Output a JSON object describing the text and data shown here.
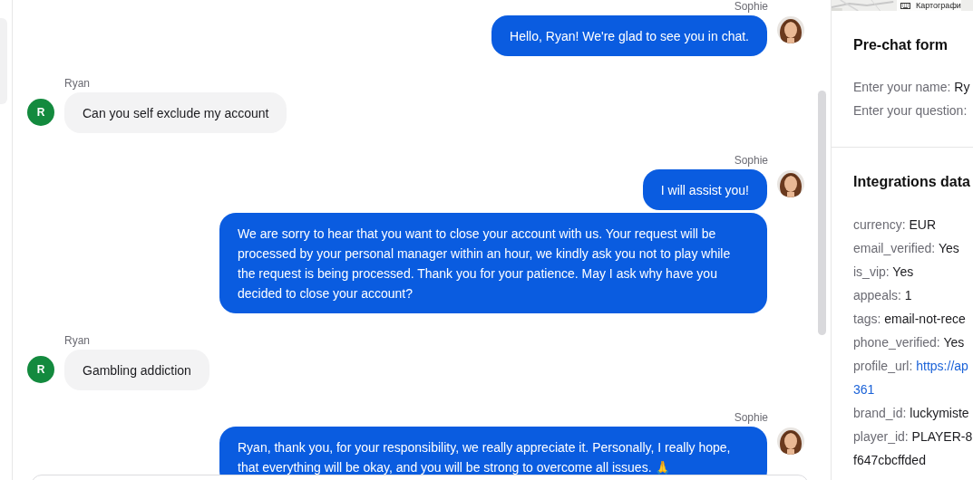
{
  "map_strip": {
    "attribution": "Картографи"
  },
  "chat": {
    "groups": [
      {
        "author": "Sophie",
        "kind": "agent",
        "avatar": {
          "kind": "picture"
        },
        "messages": [
          "Hello, Ryan! We're glad to see you in chat."
        ]
      },
      {
        "author": "Ryan",
        "kind": "visitor",
        "avatar": {
          "kind": "initial",
          "initial": "R",
          "color": "#138a3e"
        },
        "messages": [
          "Can you self exclude my account"
        ]
      },
      {
        "author": "Sophie",
        "kind": "agent",
        "avatar": {
          "kind": "picture"
        },
        "messages": [
          "I will assist you!",
          "We are sorry to hear that you want to close your account with us. Your request will be processed by your personal manager within an hour, we kindly ask you not to play while the request is being processed. Thank you for your patience. May I ask why have you decided to close your account?"
        ]
      },
      {
        "author": "Ryan",
        "kind": "visitor",
        "avatar": {
          "kind": "initial",
          "initial": "R",
          "color": "#138a3e"
        },
        "messages": [
          "Gambling addiction"
        ]
      },
      {
        "author": "Sophie",
        "kind": "agent",
        "avatar": {
          "kind": "picture"
        },
        "messages": [
          "Ryan, thank you, for your responsibility, we really appreciate it. Personally, I really hope, that everything will be okay, and you will be strong to overcome all issues. 🙏"
        ]
      }
    ]
  },
  "sidebar": {
    "sections": [
      {
        "title": "Pre-chat form",
        "items": [
          {
            "label": "Enter your name:",
            "value_lines": [
              "Ry"
            ],
            "kind": "text"
          },
          {
            "label": "Enter your question:",
            "kind": "text"
          }
        ]
      },
      {
        "title": "Integrations data",
        "items": [
          {
            "label": "currency:",
            "value_lines": [
              "EUR"
            ],
            "kind": "text"
          },
          {
            "label": "email_verified:",
            "value_lines": [
              "Yes"
            ],
            "kind": "text"
          },
          {
            "label": "is_vip:",
            "value_lines": [
              "Yes"
            ],
            "kind": "text"
          },
          {
            "label": "appeals:",
            "value_lines": [
              "1"
            ],
            "kind": "text"
          },
          {
            "label": "tags:",
            "value_lines": [
              "email-not-rece"
            ],
            "kind": "text"
          },
          {
            "label": "phone_verified:",
            "value_lines": [
              "Yes"
            ],
            "kind": "text"
          },
          {
            "label": "profile_url:",
            "value_lines": [
              "https://ap",
              "361"
            ],
            "kind": "link"
          },
          {
            "label": "brand_id:",
            "value_lines": [
              "luckymiste"
            ],
            "kind": "text"
          },
          {
            "label": "player_id:",
            "value_lines": [
              "PLAYER-8",
              "f647cbcffded"
            ],
            "kind": "text"
          }
        ]
      }
    ]
  }
}
